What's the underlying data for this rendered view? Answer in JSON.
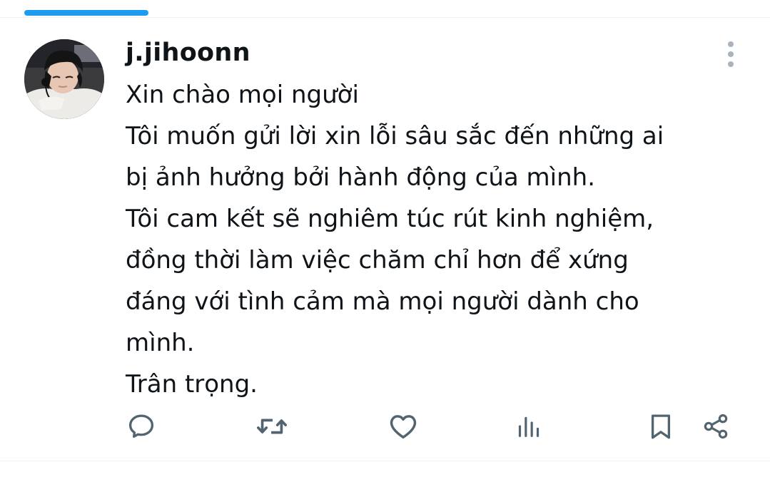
{
  "header": {
    "active_tab_color": "#1d9bf0"
  },
  "tweet": {
    "username": "j.jihoonn",
    "lines": [
      "Xin chào mọi người",
      "Tôi muốn gửi lời xin lỗi sâu sắc đến những ai",
      "bị ảnh hưởng bởi hành động của mình.",
      "Tôi cam kết sẽ nghiêm túc rút kinh nghiệm,",
      "đồng thời làm việc chăm chỉ hơn để xứng",
      "đáng với tình cảm mà mọi người dành cho",
      "mình.",
      "Trân trọng."
    ]
  },
  "icons": {
    "more": "more-vertical-icon",
    "reply": "reply-bubble-icon",
    "retweet": "retweet-arrows-icon",
    "like": "heart-icon",
    "views": "bar-chart-icon",
    "bookmark": "bookmark-icon",
    "share": "share-nodes-icon"
  },
  "colors": {
    "text": "#0f1419",
    "icon": "#536471",
    "accent": "#1d9bf0"
  }
}
